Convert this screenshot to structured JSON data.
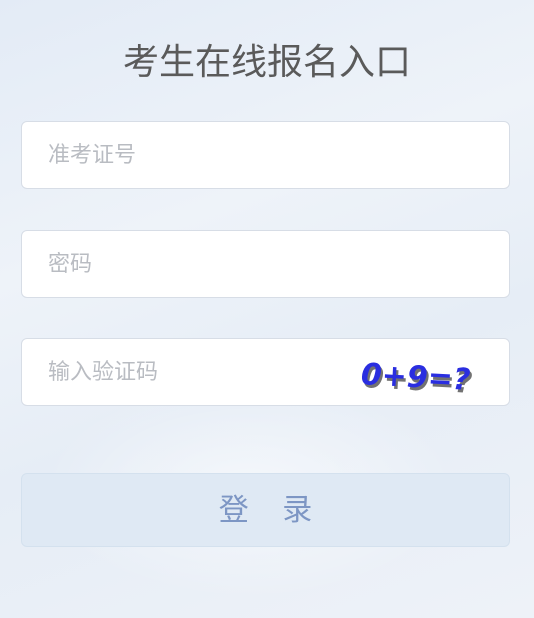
{
  "page": {
    "title": "考生在线报名入口"
  },
  "form": {
    "ticket_number": {
      "placeholder": "准考证号",
      "value": ""
    },
    "password": {
      "placeholder": "密码",
      "value": ""
    },
    "captcha_input": {
      "placeholder": "输入验证码",
      "value": ""
    },
    "captcha_image_text": "0+9=?",
    "login_label": "登 录"
  },
  "colors": {
    "title": "#5a5a5a",
    "placeholder": "#b9bcc2",
    "login_bg": "#dfe9f4",
    "login_text": "#7d96c4",
    "captcha_text": "#2a2ee0"
  }
}
